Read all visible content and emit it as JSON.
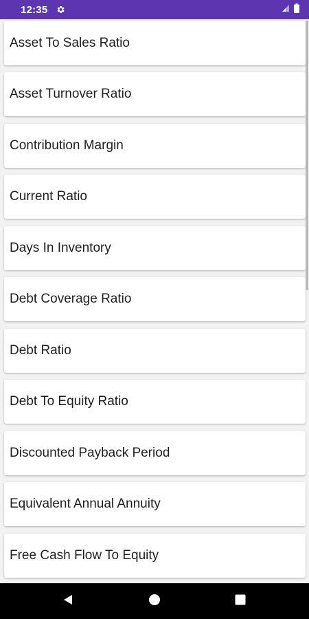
{
  "status_bar": {
    "time": "12:35",
    "icons": [
      "gear-icon",
      "signal-icon",
      "battery-icon"
    ],
    "color": "#5e35b1"
  },
  "list": {
    "items": [
      {
        "label": "Asset To Sales Ratio"
      },
      {
        "label": "Asset Turnover Ratio"
      },
      {
        "label": "Contribution Margin"
      },
      {
        "label": "Current Ratio"
      },
      {
        "label": "Days In Inventory"
      },
      {
        "label": "Debt Coverage Ratio"
      },
      {
        "label": "Debt Ratio"
      },
      {
        "label": "Debt To Equity Ratio"
      },
      {
        "label": "Discounted Payback Period"
      },
      {
        "label": "Equivalent Annual Annuity"
      },
      {
        "label": "Free Cash Flow To Equity"
      }
    ]
  },
  "nav_bar": {
    "buttons": [
      "back-icon",
      "home-icon",
      "recents-icon"
    ]
  }
}
